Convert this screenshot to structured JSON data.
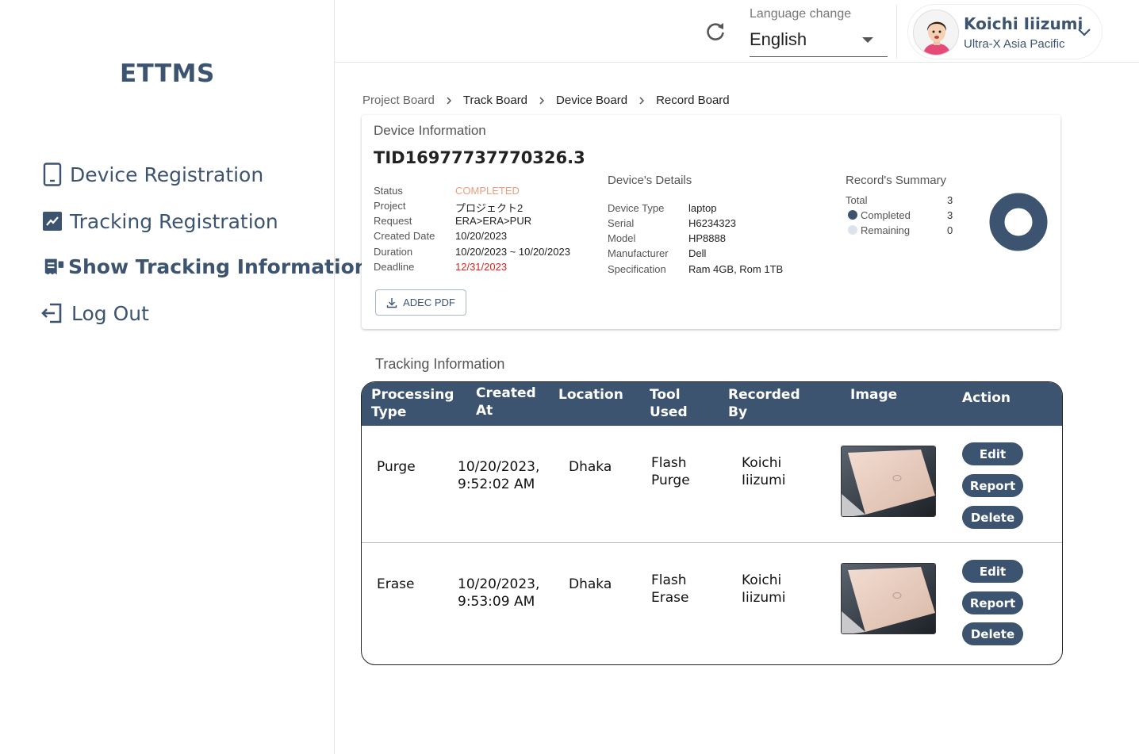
{
  "sidebar": {
    "brand": "ETTMS",
    "items": [
      {
        "label": "Device Registration",
        "icon": "tablet-icon"
      },
      {
        "label": "Tracking Registration",
        "icon": "chart-icon"
      },
      {
        "label": "Show Tracking Information",
        "icon": "receipt-icon",
        "active": true
      },
      {
        "label": "Log Out",
        "icon": "logout-icon"
      }
    ]
  },
  "header": {
    "language_label": "Language change",
    "language_value": "English",
    "user_name": "Koichi Iiizumi",
    "user_org": "Ultra-X Asia Pacific"
  },
  "breadcrumb": [
    "Project Board",
    "Track Board",
    "Device Board",
    "Record Board"
  ],
  "device": {
    "section_title": "Device Information",
    "tid": "TID16977737770326.3",
    "info_labels": [
      "Status",
      "Project",
      "Request",
      "Created Date",
      "Duration",
      "Deadline"
    ],
    "info_values": [
      "COMPLETED",
      "プロジェクト2",
      "ERA>ERA>PUR",
      "10/20/2023",
      "10/20/2023 ~ 10/20/2023",
      "12/31/2023"
    ],
    "details_title": "Device's Details",
    "details_labels": [
      "Device Type",
      "Serial",
      "Model",
      "Manufacturer",
      "Specification"
    ],
    "details_values": [
      "laptop",
      "H6234323",
      "HP8888",
      "Dell",
      "Ram 4GB, Rom 1TB"
    ],
    "summary_title": "Record's Summary",
    "summary": {
      "total_label": "Total",
      "total": "3",
      "completed_label": "Completed",
      "completed": "3",
      "remaining_label": "Remaining",
      "remaining": "0"
    },
    "pdf_button": "ADEC PDF"
  },
  "tracking": {
    "title": "Tracking Information",
    "headers": [
      "Processing Type",
      "Created At",
      "Location",
      "Tool Used",
      "Recorded By",
      "Image",
      "Action"
    ],
    "rows": [
      {
        "type": "Purge",
        "created_date": "10/20/2023,",
        "created_time": "9:52:02 AM",
        "location": "Dhaka",
        "tool_1": "Flash",
        "tool_2": "Purge",
        "by_1": "Koichi",
        "by_2": "Iiizumi"
      },
      {
        "type": "Erase",
        "created_date": "10/20/2023,",
        "created_time": "9:53:09 AM",
        "location": "Dhaka",
        "tool_1": "Flash",
        "tool_2": "Erase",
        "by_1": "Koichi",
        "by_2": "Iiizumi"
      }
    ],
    "actions": [
      "Edit",
      "Report",
      "Delete"
    ]
  },
  "colors": {
    "primary": "#3d5470",
    "completed": "#e8a07c",
    "deadline": "#e02020",
    "remaining_dot": "#dde3ec"
  }
}
